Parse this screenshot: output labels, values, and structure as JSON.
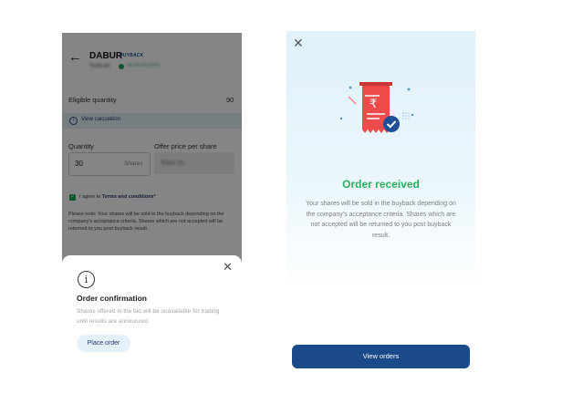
{
  "left_screen": {
    "header": {
      "title": "DABUR",
      "tag": "BUYBACK",
      "price": "₹498.40",
      "change": "+4.55 (0.92%)"
    },
    "eligible": {
      "label": "Eligible quantity",
      "value": "90"
    },
    "calculation": {
      "label": "View calculation"
    },
    "quantity": {
      "label": "Quantity",
      "value": "30",
      "unit": "Shares"
    },
    "offer_price": {
      "label": "Offer price per share",
      "value": "₹564.00"
    },
    "agreement": {
      "prefix": "I agree to ",
      "link": "Terms and conditions*"
    },
    "note": "Please note: Your shares will be sold in the buyback depending on the company's acceptance criteria. Shares which are not accepted will be returned to you post buyback result.",
    "sheet": {
      "title": "Order confirmation",
      "message": "Shares offered in the bid will be unavailable for trading until results are announced.",
      "button": "Place order"
    }
  },
  "right_screen": {
    "title": "Order received",
    "message": "Your shares will be sold in the buyback depending on the company's acceptance criteria. Shares which are not accepted will be returned to you post buyback result.",
    "button": "View orders"
  },
  "colors": {
    "brand_blue": "#1b4a8a",
    "success_green": "#2bb15d",
    "receipt_red": "#ee4b4b",
    "light_blue": "#e5f1f8"
  },
  "icons": {
    "back": "arrow-left-icon",
    "close": "close-icon",
    "info": "info-circle-icon",
    "check": "check-icon",
    "receipt": "receipt-rupee-icon"
  }
}
